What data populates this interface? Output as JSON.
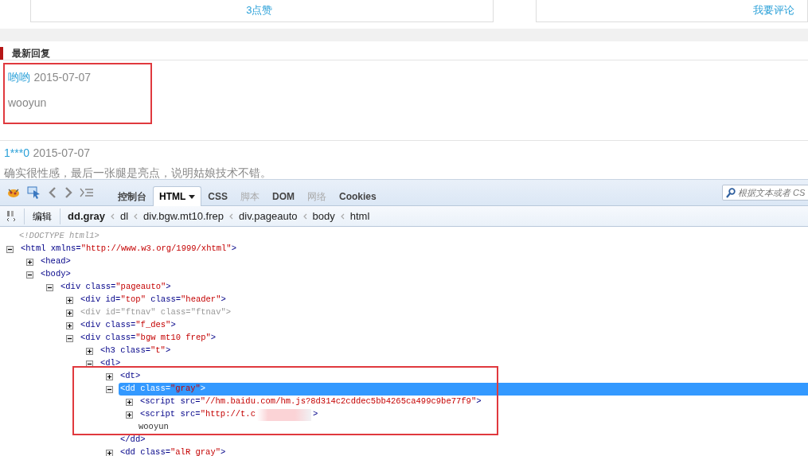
{
  "page": {
    "actions": [
      {
        "label": "3点赞"
      },
      {
        "label": "我要评论"
      }
    ],
    "replies_heading": "最新回复",
    "replies": [
      {
        "user": "哟哟",
        "date": "2015-07-07",
        "text": "wooyun",
        "framed": true
      },
      {
        "user": "1***0",
        "date": "2015-07-07",
        "text": "确实很性感，最后一张腿是亮点，说明姑娘技术不错。",
        "framed": false
      }
    ]
  },
  "devtools": {
    "tabs": [
      {
        "label": "控制台",
        "selected": false,
        "disabled": false,
        "has_menu": false
      },
      {
        "label": "HTML",
        "selected": true,
        "disabled": false,
        "has_menu": true
      },
      {
        "label": "CSS",
        "selected": false,
        "disabled": false,
        "has_menu": false
      },
      {
        "label": "脚本",
        "selected": false,
        "disabled": true,
        "has_menu": false
      },
      {
        "label": "DOM",
        "selected": false,
        "disabled": false,
        "has_menu": false
      },
      {
        "label": "网络",
        "selected": false,
        "disabled": true,
        "has_menu": false
      },
      {
        "label": "Cookies",
        "selected": false,
        "disabled": false,
        "has_menu": false
      }
    ],
    "search": {
      "placeholder": "根据文本或者 CS"
    },
    "edit_button": "编辑",
    "breadcrumb": [
      {
        "label": "dd.gray",
        "selected": true
      },
      {
        "label": "dl",
        "selected": false
      },
      {
        "label": "div.bgw.mt10.frep",
        "selected": false
      },
      {
        "label": "div.pageauto",
        "selected": false
      },
      {
        "label": "body",
        "selected": false
      },
      {
        "label": "html",
        "selected": false
      }
    ],
    "tree": [
      {
        "kind": "doctype",
        "markup": "<!DOCTYPE html1>"
      },
      {
        "kind": "element",
        "markup": "<html xmlns=\"http://www.w3.org/1999/xhtml\">",
        "expanded": true,
        "children": [
          {
            "kind": "element",
            "markup": "<head>",
            "expanded": false
          },
          {
            "kind": "element",
            "markup": "<body>",
            "expanded": true,
            "children": [
              {
                "kind": "element",
                "markup": "<div class=\"pageauto\">",
                "expanded": true,
                "children": [
                  {
                    "kind": "element",
                    "markup": "<div id=\"top\" class=\"header\">",
                    "expanded": false
                  },
                  {
                    "kind": "element",
                    "markup": "<div id=\"ftnav\" class=\"ftnav\">",
                    "expanded": false,
                    "dimmed": true
                  },
                  {
                    "kind": "element",
                    "markup": "<div class=\"f_des\">",
                    "expanded": false
                  },
                  {
                    "kind": "element",
                    "markup": "<div class=\"bgw mt10 frep\">",
                    "expanded": true,
                    "children": [
                      {
                        "kind": "element",
                        "markup": "<h3 class=\"t\">",
                        "expanded": false
                      },
                      {
                        "kind": "element",
                        "markup": "<dl>",
                        "expanded": true,
                        "children": [
                          {
                            "kind": "element",
                            "markup": "<dt>",
                            "expanded": false,
                            "framed": true
                          },
                          {
                            "kind": "element",
                            "markup": "<dd class=\"gray\">",
                            "expanded": true,
                            "selected": true,
                            "framed": true,
                            "closing": "</dd>",
                            "children": [
                              {
                                "kind": "element",
                                "markup": "<script src=\"//hm.baidu.com/hm.js?8d314c2cddec5bb4265ca499c9be77f9\">",
                                "expanded": false
                              },
                              {
                                "kind": "element",
                                "markup": "<script src=\"http://t.c",
                                "tail": ">",
                                "expanded": false,
                                "redacted": true
                              },
                              {
                                "kind": "text",
                                "text": "wooyun"
                              }
                            ]
                          },
                          {
                            "kind": "element",
                            "markup": "<dd class=\"alR gray\">",
                            "expanded": false
                          }
                        ]
                      }
                    ]
                  }
                ]
              }
            ]
          }
        ]
      }
    ]
  }
}
